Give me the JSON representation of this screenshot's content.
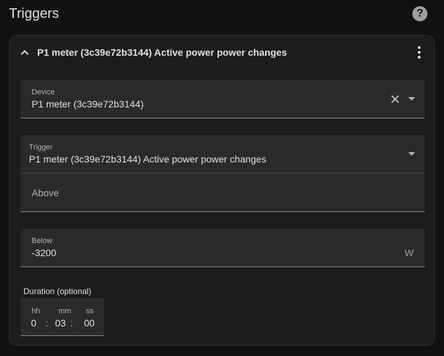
{
  "page": {
    "title": "Triggers",
    "help_icon": "help-circle-icon",
    "help_glyph": "?"
  },
  "trigger_card": {
    "title": "P1 meter (3c39e72b3144) Active power power changes",
    "collapse_icon": "chevron-up-icon",
    "menu_icon": "more-vertical-icon",
    "device": {
      "label": "Device",
      "value": "P1 meter (3c39e72b3144)",
      "clear_icon": "close-icon",
      "dropdown_icon": "caret-down-icon"
    },
    "trigger": {
      "label": "Trigger",
      "value": "P1 meter (3c39e72b3144) Active power power changes",
      "dropdown_icon": "caret-down-icon"
    },
    "above": {
      "placeholder": "Above",
      "value": ""
    },
    "below": {
      "label": "Below",
      "value": "-3200",
      "unit": "W"
    },
    "duration": {
      "label": "Duration (optional)",
      "hours_label": "hh",
      "minutes_label": "mm",
      "seconds_label": "ss",
      "hours": "0",
      "minutes": "03",
      "seconds": "00",
      "separator": ":"
    }
  },
  "colors": {
    "background": "#111111",
    "card": "#1c1c1c",
    "field": "#2a2a2a",
    "text": "#e1e1e1",
    "muted": "#b5b5b5"
  }
}
